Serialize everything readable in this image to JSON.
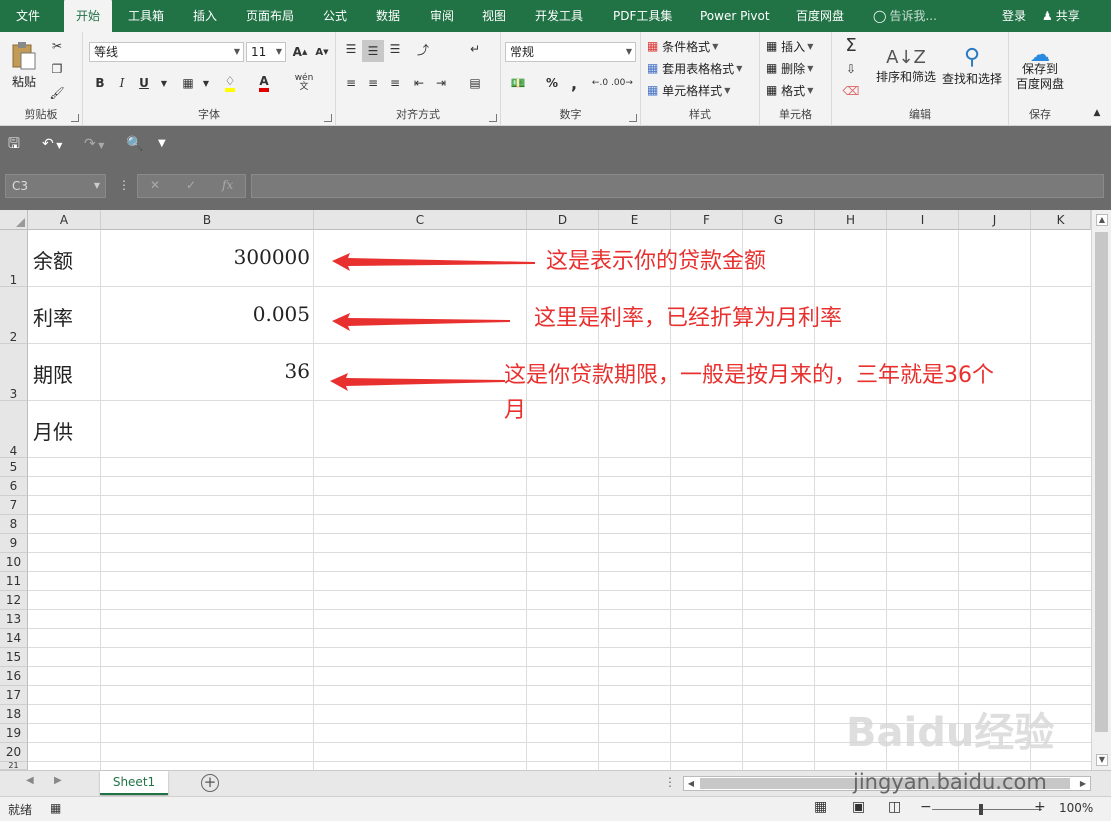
{
  "ribbon_tabs": [
    "文件",
    "开始",
    "工具箱",
    "插入",
    "页面布局",
    "公式",
    "数据",
    "审阅",
    "视图",
    "开发工具",
    "PDF工具集",
    "Power Pivot",
    "百度网盘"
  ],
  "tell_me": "告诉我...",
  "account": {
    "login": "登录",
    "share": "共享"
  },
  "groups": {
    "clipboard": {
      "label": "剪贴板",
      "paste": "粘贴"
    },
    "font": {
      "label": "字体",
      "name": "等线",
      "size": "11",
      "bold": "B",
      "italic": "I",
      "underline": "U",
      "wen": "wén"
    },
    "align": {
      "label": "对齐方式"
    },
    "number": {
      "label": "数字",
      "format": "常规",
      "percent": "%",
      "comma": ","
    },
    "styles": {
      "label": "样式",
      "cond": "条件格式",
      "table": "套用表格格式",
      "cell": "单元格样式"
    },
    "cells": {
      "label": "单元格",
      "insert": "插入",
      "delete": "删除",
      "format": "格式"
    },
    "edit": {
      "label": "编辑",
      "sort": "排序和筛选",
      "find": "查找和选择"
    },
    "save": {
      "label": "保存",
      "btn1": "保存到",
      "btn2": "百度网盘"
    }
  },
  "name_box": "C3",
  "columns": [
    "A",
    "B",
    "C",
    "D",
    "E",
    "F",
    "G",
    "H",
    "I",
    "J",
    "K"
  ],
  "rows": [
    "1",
    "2",
    "3",
    "4",
    "5",
    "6",
    "7",
    "8",
    "9",
    "10",
    "11",
    "12",
    "13",
    "14",
    "15",
    "16",
    "17",
    "18",
    "19",
    "20",
    "21"
  ],
  "cells": [
    {
      "ref": "A1",
      "value": "余额"
    },
    {
      "ref": "B1",
      "value": "300000"
    },
    {
      "ref": "A2",
      "value": "利率"
    },
    {
      "ref": "B2",
      "value": "0.005"
    },
    {
      "ref": "A3",
      "value": "期限"
    },
    {
      "ref": "B3",
      "value": "36"
    },
    {
      "ref": "A4",
      "value": "月供"
    }
  ],
  "annotations": [
    {
      "text": "这是表示你的贷款金额"
    },
    {
      "text": "这里是利率，已经折算为月利率"
    },
    {
      "text": "这是你贷款期限，一般是按月来的，三年就是36个"
    },
    {
      "text": "月"
    }
  ],
  "annotation_color": "#e8312f",
  "accent_color": "#217346",
  "sheet_tab": "Sheet1",
  "status": {
    "ready": "就绪",
    "zoom": "100%"
  },
  "watermark": {
    "logo": "Baidu经验",
    "url": "jingyan.baidu.com"
  }
}
